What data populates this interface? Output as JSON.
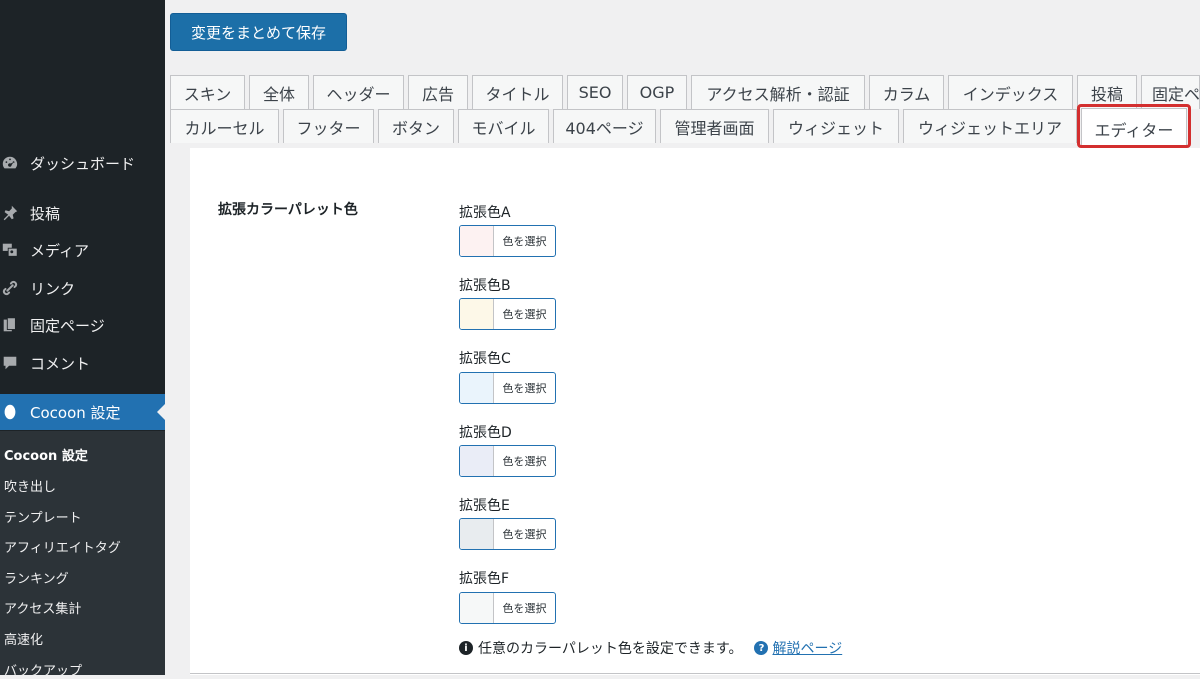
{
  "toolbar": {
    "save_label": "変更をまとめて保存"
  },
  "tabs_row1": [
    "スキン",
    "全体",
    "ヘッダー",
    "広告",
    "タイトル",
    "SEO",
    "OGP",
    "アクセス解析・認証",
    "カラム",
    "インデックス",
    "投稿",
    "固定ペ"
  ],
  "tabs_row2": [
    "カルーセル",
    "フッター",
    "ボタン",
    "モバイル",
    "404ページ",
    "管理者画面",
    "ウィジェット",
    "ウィジェットエリア",
    "エディター"
  ],
  "active_tab": "エディター",
  "sidebar": {
    "items": [
      {
        "label": "ダッシュボード",
        "icon": "dashboard-icon"
      },
      {
        "label": "投稿",
        "icon": "pin-icon"
      },
      {
        "label": "メディア",
        "icon": "media-icon"
      },
      {
        "label": "リンク",
        "icon": "link-icon"
      },
      {
        "label": "固定ページ",
        "icon": "pages-icon"
      },
      {
        "label": "コメント",
        "icon": "comment-icon"
      },
      {
        "label": "Cocoon 設定",
        "icon": "cocoon-icon"
      }
    ],
    "submenu": [
      "Cocoon 設定",
      "吹き出し",
      "テンプレート",
      "アフィリエイトタグ",
      "ランキング",
      "アクセス集計",
      "高速化",
      "バックアップ"
    ]
  },
  "settings": {
    "label": "拡張カラーパレット色",
    "colors": [
      {
        "name": "拡張色A",
        "swatch": "#fdf2f2",
        "button": "色を選択"
      },
      {
        "name": "拡張色B",
        "swatch": "#fdf8e8",
        "button": "色を選択"
      },
      {
        "name": "拡張色C",
        "swatch": "#eaf4fc",
        "button": "色を選択"
      },
      {
        "name": "拡張色D",
        "swatch": "#eaedf7",
        "button": "色を選択"
      },
      {
        "name": "拡張色E",
        "swatch": "#e8ecef",
        "button": "色を選択"
      },
      {
        "name": "拡張色F",
        "swatch": "#f6f8f8",
        "button": "色を選択"
      }
    ],
    "description": "任意のカラーパレット色を設定できます。",
    "help_link": "解説ページ"
  },
  "colors": {
    "accent": "#2271b1",
    "highlight": "#d32f2f",
    "sidebar": "#1d2327"
  }
}
